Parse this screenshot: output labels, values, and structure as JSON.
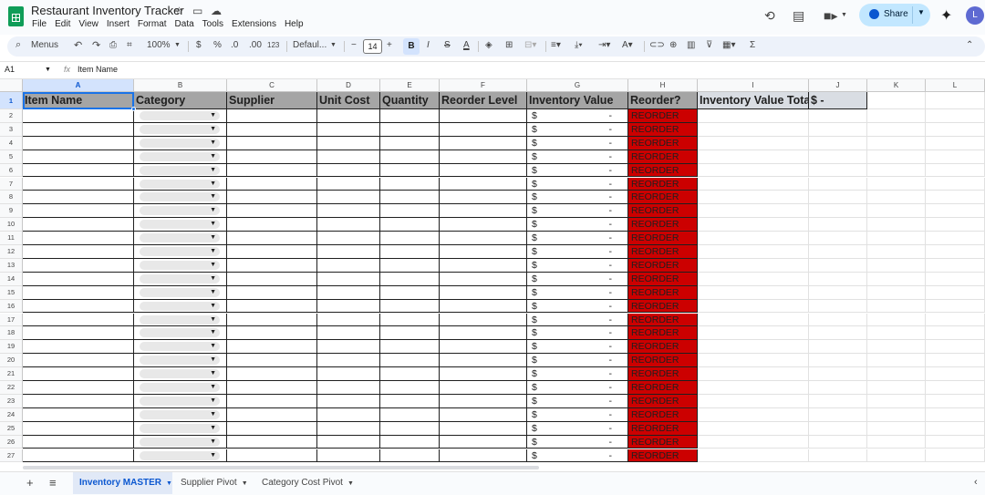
{
  "app": {
    "doc_title": "Restaurant Inventory Tracker",
    "menus": [
      "File",
      "Edit",
      "View",
      "Insert",
      "Format",
      "Data",
      "Tools",
      "Extensions",
      "Help"
    ],
    "share_label": "Share",
    "avatar_letter": "L"
  },
  "toolbar": {
    "search_label": "Menus",
    "zoom": "100%",
    "currency": "$",
    "percent": "%",
    "dec_decrease": ".0",
    "dec_increase": ".00",
    "number_format": "123",
    "font": "Defaul...",
    "font_size": "14",
    "bold": "B",
    "italic": "I",
    "strike": "S",
    "text_color": "A"
  },
  "formula_bar": {
    "name_box": "A1",
    "fx": "fx",
    "value": "Item Name"
  },
  "columns": [
    "A",
    "B",
    "C",
    "D",
    "E",
    "F",
    "G",
    "H",
    "I",
    "J",
    "K",
    "L"
  ],
  "headers": [
    "Item Name",
    "Category",
    "Supplier",
    "Unit Cost",
    "Quantity",
    "Reorder Level",
    "Inventory Value",
    "Reorder?",
    "Inventory Value Total",
    "$        -"
  ],
  "rows": [
    "1",
    "2",
    "3",
    "4",
    "5",
    "6",
    "7",
    "8",
    "9",
    "10",
    "11",
    "12",
    "13",
    "14",
    "15",
    "16",
    "17",
    "18",
    "19",
    "20",
    "21",
    "22",
    "23",
    "24",
    "25",
    "26",
    "27"
  ],
  "row_values": {
    "currency": "$",
    "dash": "-",
    "reorder": "REORDER"
  },
  "colors": {
    "reorder_fill": "#cc0000",
    "header_fill": "#a5a5a5",
    "selection": "#1a73e8"
  },
  "sheets": [
    {
      "label": "Inventory MASTER",
      "active": true
    },
    {
      "label": "Supplier Pivot",
      "active": false
    },
    {
      "label": "Category Cost Pivot",
      "active": false
    }
  ]
}
